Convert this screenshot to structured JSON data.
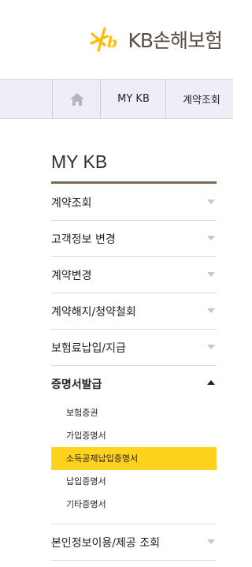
{
  "brand": {
    "name": "KB손해보험",
    "logo_icon": "kb-star-logo-icon",
    "accent": "#ffbc00"
  },
  "nav": {
    "home_icon": "home-icon",
    "items": [
      "MY KB",
      "계약조회"
    ]
  },
  "section": {
    "title": "MY KB"
  },
  "menu": [
    {
      "label": "계약조회"
    },
    {
      "label": "고객정보 변경"
    },
    {
      "label": "계약변경"
    },
    {
      "label": "계약해지/청약철회"
    },
    {
      "label": "보험료납입/지급"
    },
    {
      "label": "증명서발급",
      "expanded": true,
      "children": [
        "보험증권",
        "가입증명서",
        "소득공제납입증명서",
        "납입증명서",
        "기타증명서"
      ],
      "selected_child": "소득공제납입증명서"
    },
    {
      "label": "본인정보이용/제공 조회"
    }
  ],
  "colors": {
    "highlight": "#ffd21e",
    "title_bar": "#7a6a55",
    "nav_bg": "#eeeef7"
  }
}
